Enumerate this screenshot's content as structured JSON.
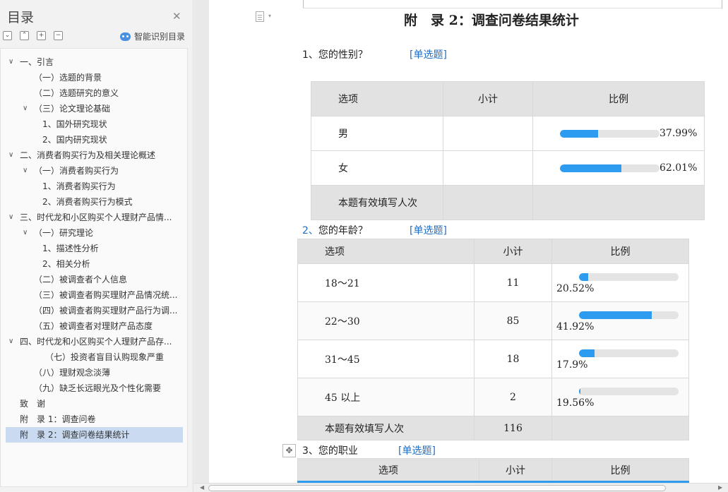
{
  "sidebar": {
    "title": "目录",
    "smart_label": "智能识别目录",
    "toc": [
      {
        "label": "一、引言",
        "level": 0,
        "expanded": true
      },
      {
        "label": "（一）选题的背景",
        "level": 2
      },
      {
        "label": "（二）选题研究的意义",
        "level": 2
      },
      {
        "label": "（三）论文理论基础",
        "level": 1,
        "expanded": true
      },
      {
        "label": "1、国外研究现状",
        "level": 3
      },
      {
        "label": "2、国内研究现状",
        "level": 3
      },
      {
        "label": "二、消费者购买行为及相关理论概述",
        "level": 0,
        "expanded": true
      },
      {
        "label": "（一）消费者购买行为",
        "level": 1,
        "expanded": true
      },
      {
        "label": "1、消费者购买行为",
        "level": 3
      },
      {
        "label": "2、消费者购买行为模式",
        "level": 3
      },
      {
        "label": "三、时代龙和小区购买个人理财产品情...",
        "level": 0,
        "expanded": true
      },
      {
        "label": "（一）研究理论",
        "level": 1,
        "expanded": true
      },
      {
        "label": "1、描述性分析",
        "level": 3
      },
      {
        "label": "2、相关分析",
        "level": 3
      },
      {
        "label": "（二）被调查者个人信息",
        "level": 2
      },
      {
        "label": "（三）被调查者购买理财产品情况统...",
        "level": 2
      },
      {
        "label": "（四）被调查者购买理财产品行为调...",
        "level": 2
      },
      {
        "label": "（五）被调查者对理财产品态度",
        "level": 2
      },
      {
        "label": "四、时代龙和小区购买个人理财产品存...",
        "level": 0,
        "expanded": true
      },
      {
        "label": "（七）投资者盲目认购现象严重",
        "level": 4
      },
      {
        "label": "（八）理财观念淡薄",
        "level": 2
      },
      {
        "label": "（九）缺乏长远眼光及个性化需要",
        "level": 2
      },
      {
        "label": "致　谢",
        "level": -1
      },
      {
        "label": "附　录 1：调查问卷",
        "level": -1
      },
      {
        "label": "附　录 2：调查问卷结果统计",
        "level": -1,
        "selected": true
      }
    ]
  },
  "document": {
    "title": "附　录 2：调查问卷结果统计",
    "q1": {
      "number": "1、",
      "text": "您的性别？",
      "tag": "[单选题]",
      "headers": [
        "选项",
        "小计",
        "比例"
      ],
      "rows": [
        {
          "option": "男",
          "count": "",
          "percent_label": "37.99%",
          "ratio": 0.3799
        },
        {
          "option": "女",
          "count": "",
          "percent_label": "62.01%",
          "ratio": 0.6201
        }
      ],
      "footer": {
        "label": "本题有效填写人次",
        "count": ""
      }
    },
    "q2": {
      "number": "2、",
      "text": "您的年龄？",
      "tag": "[单选题]",
      "headers": [
        "选项",
        "小计",
        "比例"
      ],
      "rows": [
        {
          "option": "18～21",
          "count": "11",
          "percent_label": "20.52%",
          "ratio": 0.0948
        },
        {
          "option": "22～30",
          "count": "85",
          "percent_label": "41.92%",
          "ratio": 0.7328
        },
        {
          "option": "31～45",
          "count": "18",
          "percent_label": "17.9%",
          "ratio": 0.1552
        },
        {
          "option": "45 以上",
          "count": "2",
          "percent_label": "19.56%",
          "ratio": 0.0172
        }
      ],
      "footer": {
        "label": "本题有效填写人次",
        "count": "116"
      }
    },
    "q3": {
      "number": "3、",
      "text": "您的职业",
      "tag": "[单选题]",
      "headers": [
        "选项",
        "小计",
        "比例"
      ]
    }
  },
  "colors": {
    "accent": "#2d9cf0",
    "link": "#1f6fc4",
    "selected_row": "#c9daf1",
    "table_header": "#e2e2e2"
  }
}
